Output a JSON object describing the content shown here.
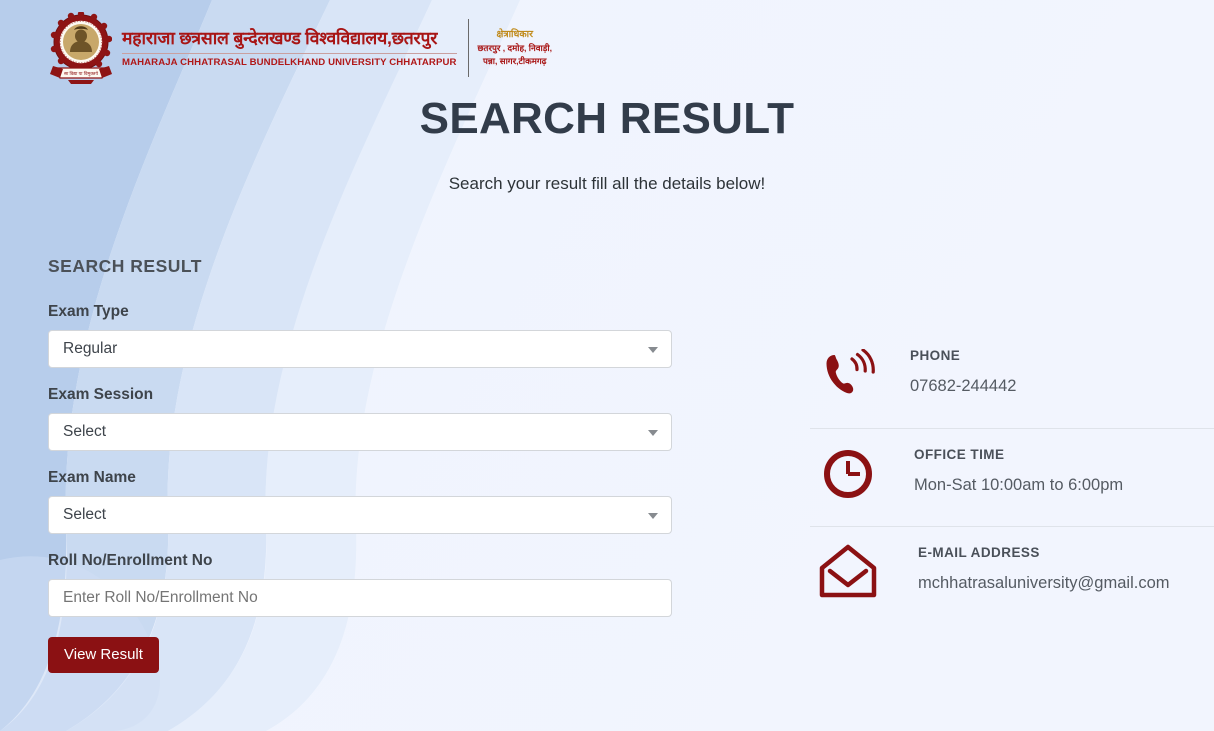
{
  "header": {
    "crest_icon": "university-crest-icon",
    "brand_hindi": "महाराजा छत्रसाल बुन्देलखण्ड विश्वविद्यालय,छतरपुर",
    "brand_english": "MAHARAJA CHHATRASAL BUNDELKHAND UNIVERSITY CHHATARPUR",
    "jurisdiction_title": "क्षेत्राधिकार",
    "jurisdiction_line1": "छतरपुर , दमोह, निवाड़ी,",
    "jurisdiction_line2": "पन्ना, सागर,टीकमगढ़"
  },
  "hero": {
    "title": "SEARCH RESULT",
    "subtitle": "Search your result fill all the details below!"
  },
  "form": {
    "heading": "SEARCH RESULT",
    "exam_type": {
      "label": "Exam Type",
      "value": "Regular",
      "icon": "chevron-down-icon"
    },
    "exam_session": {
      "label": "Exam Session",
      "value": "Select",
      "icon": "chevron-down-icon"
    },
    "exam_name": {
      "label": "Exam Name",
      "value": "Select",
      "icon": "chevron-down-icon"
    },
    "roll_no": {
      "label": "Roll No/Enrollment No",
      "value": "",
      "placeholder": "Enter Roll No/Enrollment No"
    },
    "submit_label": "View Result"
  },
  "contact": {
    "phone": {
      "icon": "ringing-phone-icon",
      "title": "PHONE",
      "value": "07682-244442"
    },
    "office_time": {
      "icon": "clock-icon",
      "title": "OFFICE TIME",
      "value": "Mon-Sat 10:00am to 6:00pm"
    },
    "email": {
      "icon": "envelope-icon",
      "title": "E-MAIL ADDRESS",
      "value": "mchhatrasaluniversity@gmail.com"
    }
  },
  "colors": {
    "brand_red": "#a81515",
    "button_red": "#8b1113",
    "icon_red": "#8b1113",
    "accent_gold": "#c08a1a",
    "page_bg": "#f0f4fd",
    "bg_blue_dark": "#b6cdeb",
    "heading_text": "#323c4a"
  }
}
